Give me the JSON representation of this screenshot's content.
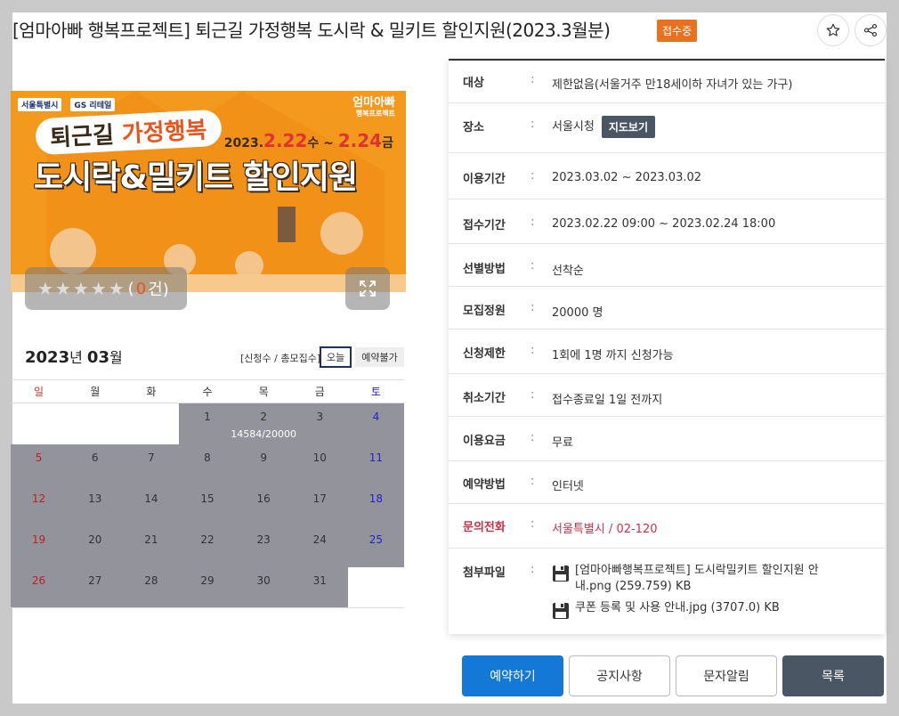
{
  "title": "[엄마아빠 행복프로젝트] 퇴근길 가정행복 도시락 & 밀키트 할인지원(2023.3월분)",
  "status_badge": "접수중",
  "poster": {
    "logo_seoul": "서울특별시",
    "logo_gs": "GS 리테일",
    "brand": "엄마아빠",
    "brand_sub": "행복프로젝트",
    "subtitle_a": "퇴근길 ",
    "subtitle_b": "가정행복",
    "date_a": "2023.",
    "date_b": "2.22",
    "date_c": "수 ~ ",
    "date_d": "2.24",
    "date_e": "금",
    "headline": "도시락&밀키트 할인지원"
  },
  "rating": {
    "stars": "★★★★★",
    "open": "(",
    "count": "0",
    "close": " 건)"
  },
  "calendar": {
    "year": "2023",
    "year_suffix": "년 ",
    "month": "03",
    "month_suffix": "월",
    "legend": "[신청수 / 총모집수]",
    "today_label": "오늘",
    "no_reservation_label": "예약불가",
    "weekdays": [
      "일",
      "월",
      "화",
      "수",
      "목",
      "금",
      "토"
    ],
    "days": [
      "1",
      "2",
      "3",
      "4",
      "5",
      "6",
      "7",
      "8",
      "9",
      "10",
      "11",
      "12",
      "13",
      "14",
      "15",
      "16",
      "17",
      "18",
      "19",
      "20",
      "21",
      "22",
      "23",
      "24",
      "25",
      "26",
      "27",
      "28",
      "29",
      "30",
      "31"
    ],
    "capacity_note": "14584/20000"
  },
  "info": {
    "target": {
      "label": "대상",
      "value": "제한없음(서울거주 만18세이하 자녀가 있는 가구)"
    },
    "place": {
      "label": "장소",
      "value": "서울시청",
      "map_button": "지도보기"
    },
    "use_period": {
      "label": "이용기간",
      "value": "2023.03.02 ~ 2023.03.02"
    },
    "apply_period": {
      "label": "접수기간",
      "value": "2023.02.22 09:00 ~ 2023.02.24 18:00"
    },
    "selection": {
      "label": "선별방법",
      "value": "선착순"
    },
    "capacity": {
      "label": "모집정원",
      "value": "20000 명"
    },
    "limit": {
      "label": "신청제한",
      "value": "1회에 1명 까지 신청가능"
    },
    "cancel": {
      "label": "취소기간",
      "value": "접수종료일 1일 전까지"
    },
    "fee": {
      "label": "이용요금",
      "value": "무료"
    },
    "method": {
      "label": "예약방법",
      "value": "인터넷"
    },
    "contact": {
      "label": "문의전화",
      "value": "서울특별시 / 02-120"
    },
    "attachments": {
      "label": "첨부파일",
      "files": [
        "[엄마아빠행복프로젝트] 도시락밀키트 할인지원 안내.png (259.759) KB",
        "쿠폰 등록 및 사용 안내.jpg (3707.0) KB"
      ]
    },
    "colon": ":"
  },
  "buttons": {
    "reserve": "예약하기",
    "notice": "공지사항",
    "sms": "문자알림",
    "list": "목록"
  },
  "colors": {
    "accent": "#1479d6",
    "badge": "#e8711f",
    "dark": "#4a5663",
    "calendar_fill": "#93939b",
    "contact_red": "#c8314a"
  }
}
